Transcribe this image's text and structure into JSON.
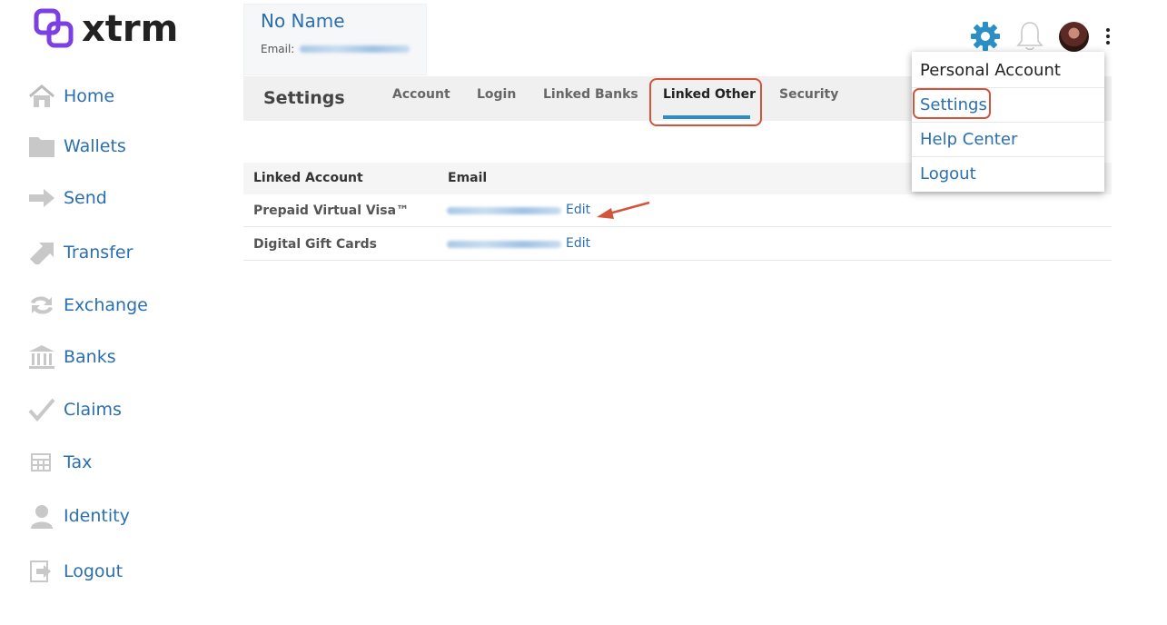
{
  "app": {
    "logo_text": "xtrm"
  },
  "sidebar": {
    "items": [
      {
        "label": "Home",
        "icon": "home-icon"
      },
      {
        "label": "Wallets",
        "icon": "folder-icon"
      },
      {
        "label": "Send",
        "icon": "arrow-right-icon"
      },
      {
        "label": "Transfer",
        "icon": "transfer-icon"
      },
      {
        "label": "Exchange",
        "icon": "exchange-icon"
      },
      {
        "label": "Banks",
        "icon": "bank-icon"
      },
      {
        "label": "Claims",
        "icon": "checkmark-icon"
      },
      {
        "label": "Tax",
        "icon": "tax-icon"
      },
      {
        "label": "Identity",
        "icon": "person-icon"
      },
      {
        "label": "Logout",
        "icon": "logout-icon"
      }
    ]
  },
  "profile": {
    "name": "No Name",
    "email_label": "Email:"
  },
  "settings": {
    "title": "Settings",
    "tabs": [
      {
        "label": "Account"
      },
      {
        "label": "Login"
      },
      {
        "label": "Linked Banks"
      },
      {
        "label": "Linked Other",
        "active": true
      },
      {
        "label": "Security"
      }
    ]
  },
  "table": {
    "headers": [
      "Linked Account",
      "Email"
    ],
    "rows": [
      {
        "name": "Prepaid Virtual Visa™",
        "action": "Edit"
      },
      {
        "name": "Digital Gift Cards",
        "action": "Edit"
      }
    ]
  },
  "dropdown": {
    "items": [
      {
        "label": "Personal Account"
      },
      {
        "label": "Settings"
      },
      {
        "label": "Help Center"
      },
      {
        "label": "Logout"
      }
    ]
  },
  "colors": {
    "link": "#2a6fb1",
    "accent": "#2b8fc6",
    "highlight": "#d2553b",
    "brand_purple": "#7b3fe4"
  }
}
